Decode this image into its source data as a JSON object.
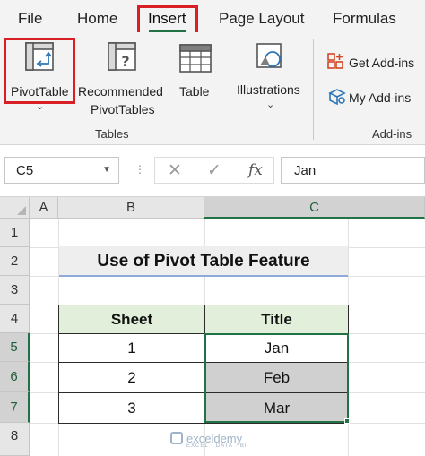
{
  "menu": {
    "tabs": [
      "File",
      "Home",
      "Insert",
      "Page Layout",
      "Formulas"
    ],
    "active_tab": "Insert"
  },
  "ribbon": {
    "tables_group": {
      "pivottable": "PivotTable",
      "recommended_line1": "Recommended",
      "recommended_line2": "PivotTables",
      "table": "Table",
      "label": "Tables"
    },
    "illustrations": "Illustrations",
    "addins_group": {
      "get_addins": "Get Add-ins",
      "my_addins": "My Add-ins",
      "label": "Add-ins"
    },
    "caret": "⌄"
  },
  "formula_bar": {
    "name_box": "C5",
    "cancel_icon": "✕",
    "enter_icon": "✓",
    "insert_function": "fx",
    "content": "Jan"
  },
  "grid": {
    "columns": [
      "A",
      "B",
      "C"
    ],
    "active_column": "C",
    "rows": [
      "1",
      "2",
      "3",
      "4",
      "5",
      "6",
      "7",
      "8"
    ],
    "active_rows": [
      "5",
      "6",
      "7"
    ],
    "title": "Use of Pivot Table Feature",
    "table": {
      "headers": [
        "Sheet",
        "Title"
      ],
      "rows": [
        [
          "1",
          "Jan"
        ],
        [
          "2",
          "Feb"
        ],
        [
          "3",
          "Mar"
        ]
      ]
    }
  },
  "watermark": {
    "name": "exceldemy",
    "tagline": "EXCEL · DATA · BI"
  },
  "colors": {
    "excel_green": "#217346",
    "highlight_red": "#d91f26",
    "header_fill": "#e2efda",
    "selection_fill": "#d0d0d0",
    "title_underline": "#8eaadb"
  }
}
